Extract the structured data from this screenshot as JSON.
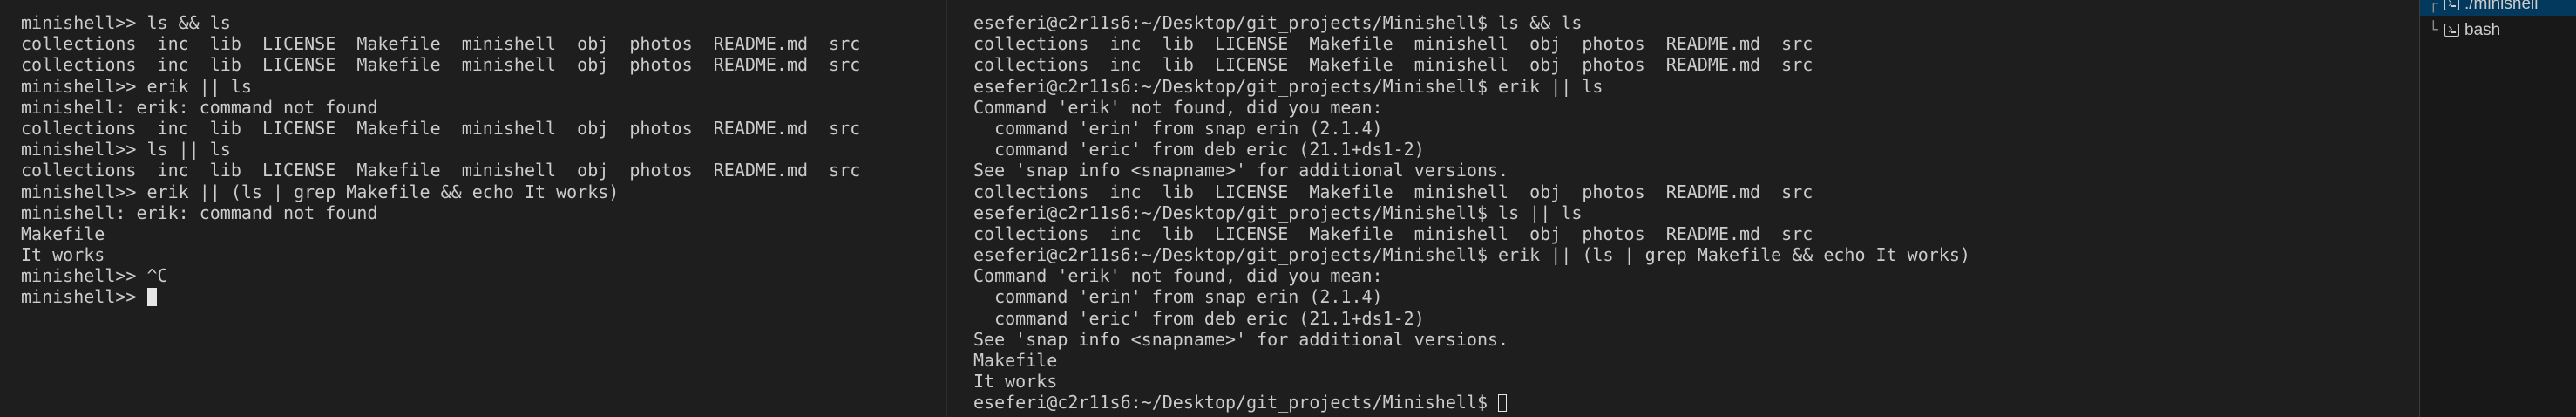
{
  "left_terminal": {
    "lines": [
      "minishell>> ls && ls",
      "collections  inc  lib  LICENSE  Makefile  minishell  obj  photos  README.md  src",
      "collections  inc  lib  LICENSE  Makefile  minishell  obj  photos  README.md  src",
      "minishell>> erik || ls",
      "minishell: erik: command not found",
      "collections  inc  lib  LICENSE  Makefile  minishell  obj  photos  README.md  src",
      "minishell>> ls || ls",
      "collections  inc  lib  LICENSE  Makefile  minishell  obj  photos  README.md  src",
      "minishell>> erik || (ls | grep Makefile && echo It works)",
      "minishell: erik: command not found",
      "Makefile",
      "It works",
      "minishell>> ^C"
    ],
    "current_prompt": "minishell>> "
  },
  "right_terminal": {
    "lines": [
      "eseferi@c2r11s6:~/Desktop/git_projects/Minishell$ ls && ls",
      "collections  inc  lib  LICENSE  Makefile  minishell  obj  photos  README.md  src",
      "collections  inc  lib  LICENSE  Makefile  minishell  obj  photos  README.md  src",
      "eseferi@c2r11s6:~/Desktop/git_projects/Minishell$ erik || ls",
      "Command 'erik' not found, did you mean:",
      "  command 'erin' from snap erin (2.1.4)",
      "  command 'eric' from deb eric (21.1+ds1-2)",
      "See 'snap info <snapname>' for additional versions.",
      "collections  inc  lib  LICENSE  Makefile  minishell  obj  photos  README.md  src",
      "eseferi@c2r11s6:~/Desktop/git_projects/Minishell$ ls || ls",
      "collections  inc  lib  LICENSE  Makefile  minishell  obj  photos  README.md  src",
      "eseferi@c2r11s6:~/Desktop/git_projects/Minishell$ erik || (ls | grep Makefile && echo It works)",
      "Command 'erik' not found, did you mean:",
      "  command 'erin' from snap erin (2.1.4)",
      "  command 'eric' from deb eric (21.1+ds1-2)",
      "See 'snap info <snapname>' for additional versions.",
      "Makefile",
      "It works"
    ],
    "current_prompt": "eseferi@c2r11s6:~/Desktop/git_projects/Minishell$ "
  },
  "terminal_list": {
    "items": [
      {
        "label": "./minishell",
        "active": true,
        "tree": "┌",
        "icon": "terminal-icon"
      },
      {
        "label": "bash",
        "active": false,
        "tree": "└",
        "icon": "terminal-icon"
      }
    ]
  },
  "colors": {
    "background": "#1e1e1e",
    "foreground": "#cccccc",
    "active_item": "#04395e"
  }
}
